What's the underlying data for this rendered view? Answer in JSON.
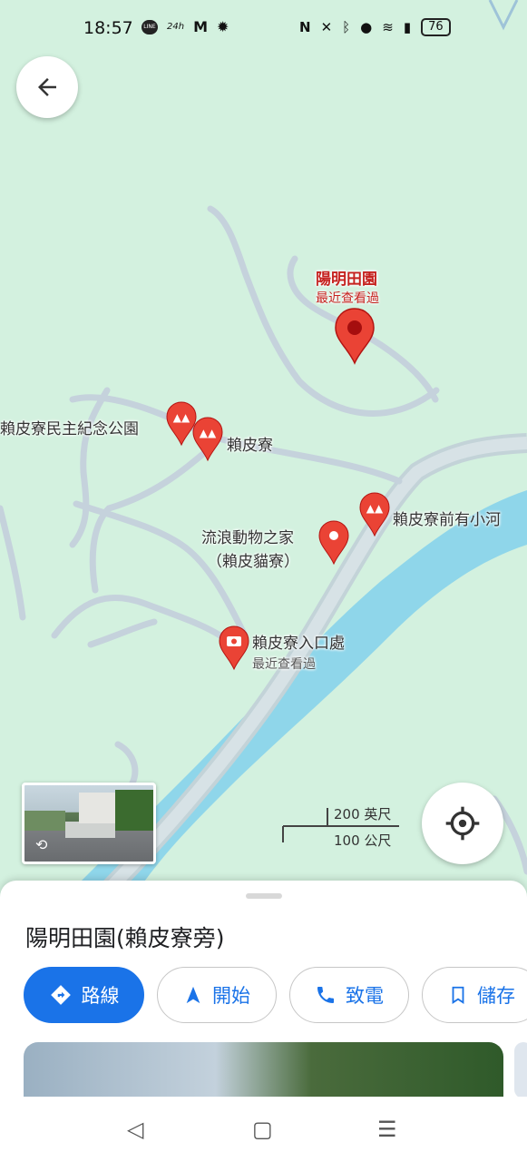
{
  "status_bar": {
    "time": "18:57",
    "left_icons": [
      "line-icon",
      "24h-icon",
      "gmail-icon",
      "bug-icon"
    ],
    "battery": "76"
  },
  "map": {
    "selected_place": {
      "title": "陽明田園",
      "subtitle": "最近查看過"
    },
    "pois": [
      {
        "name": "賴皮寮民主紀念公園"
      },
      {
        "name": "賴皮寮"
      },
      {
        "name": "賴皮寮前有小河"
      },
      {
        "line1": "流浪動物之家",
        "line2": "（賴皮貓寮）"
      },
      {
        "name": "賴皮寮入口處",
        "subtitle": "最近查看過"
      }
    ],
    "scale": {
      "imperial": "200 英尺",
      "metric": "100 公尺"
    }
  },
  "sheet": {
    "title": "陽明田園(賴皮寮旁)",
    "buttons": [
      {
        "label": "路線",
        "icon": "directions-icon"
      },
      {
        "label": "開始",
        "icon": "navigation-arrow-icon"
      },
      {
        "label": "致電",
        "icon": "phone-icon"
      },
      {
        "label": "儲存",
        "icon": "bookmark-icon"
      }
    ]
  },
  "colors": {
    "accent": "#1a73e8",
    "pin": "#ea4335",
    "label_red": "#c5221f",
    "map_bg": "#d3f1df",
    "river": "#8fd6ea"
  }
}
